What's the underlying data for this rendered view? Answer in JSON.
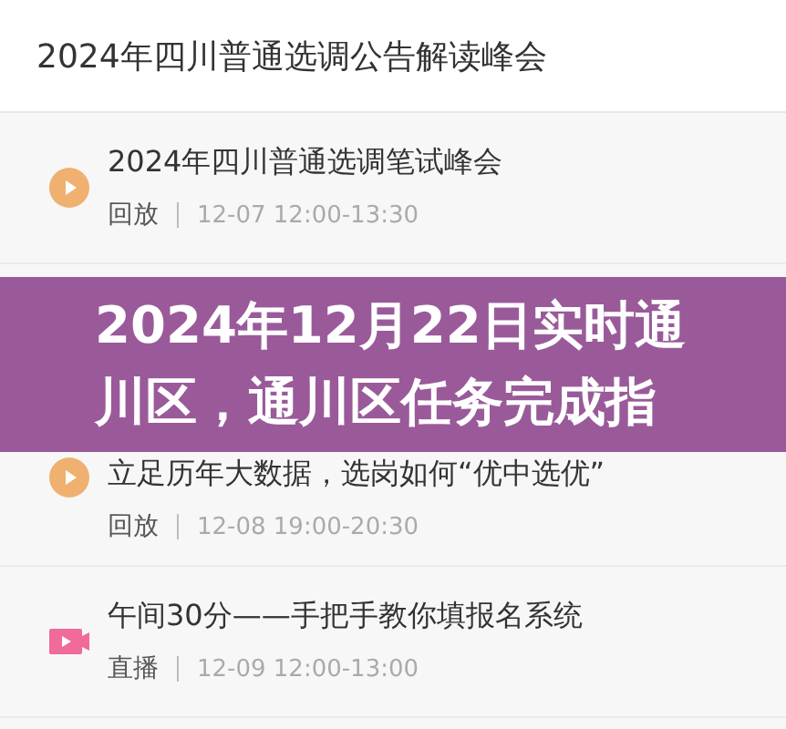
{
  "header": {
    "title": "2024年四川普通选调公告解读峰会"
  },
  "sessions": [
    {
      "kind": "replay",
      "title": "2024年四川普通选调笔试峰会",
      "status": "回放",
      "time": "12-07 12:00-13:30"
    },
    {
      "kind": "replay",
      "title": "立足历年大数据，选岗如何“优中选优”",
      "status": "回放",
      "time": "12-08 19:00-20:30"
    },
    {
      "kind": "live",
      "title": "午间30分——手把手教你填报名系统",
      "status": "直播",
      "time": "12-09 12:00-13:00"
    }
  ],
  "banner": {
    "title": "2024年12月22日实时通川区，通川区任务完成指"
  }
}
